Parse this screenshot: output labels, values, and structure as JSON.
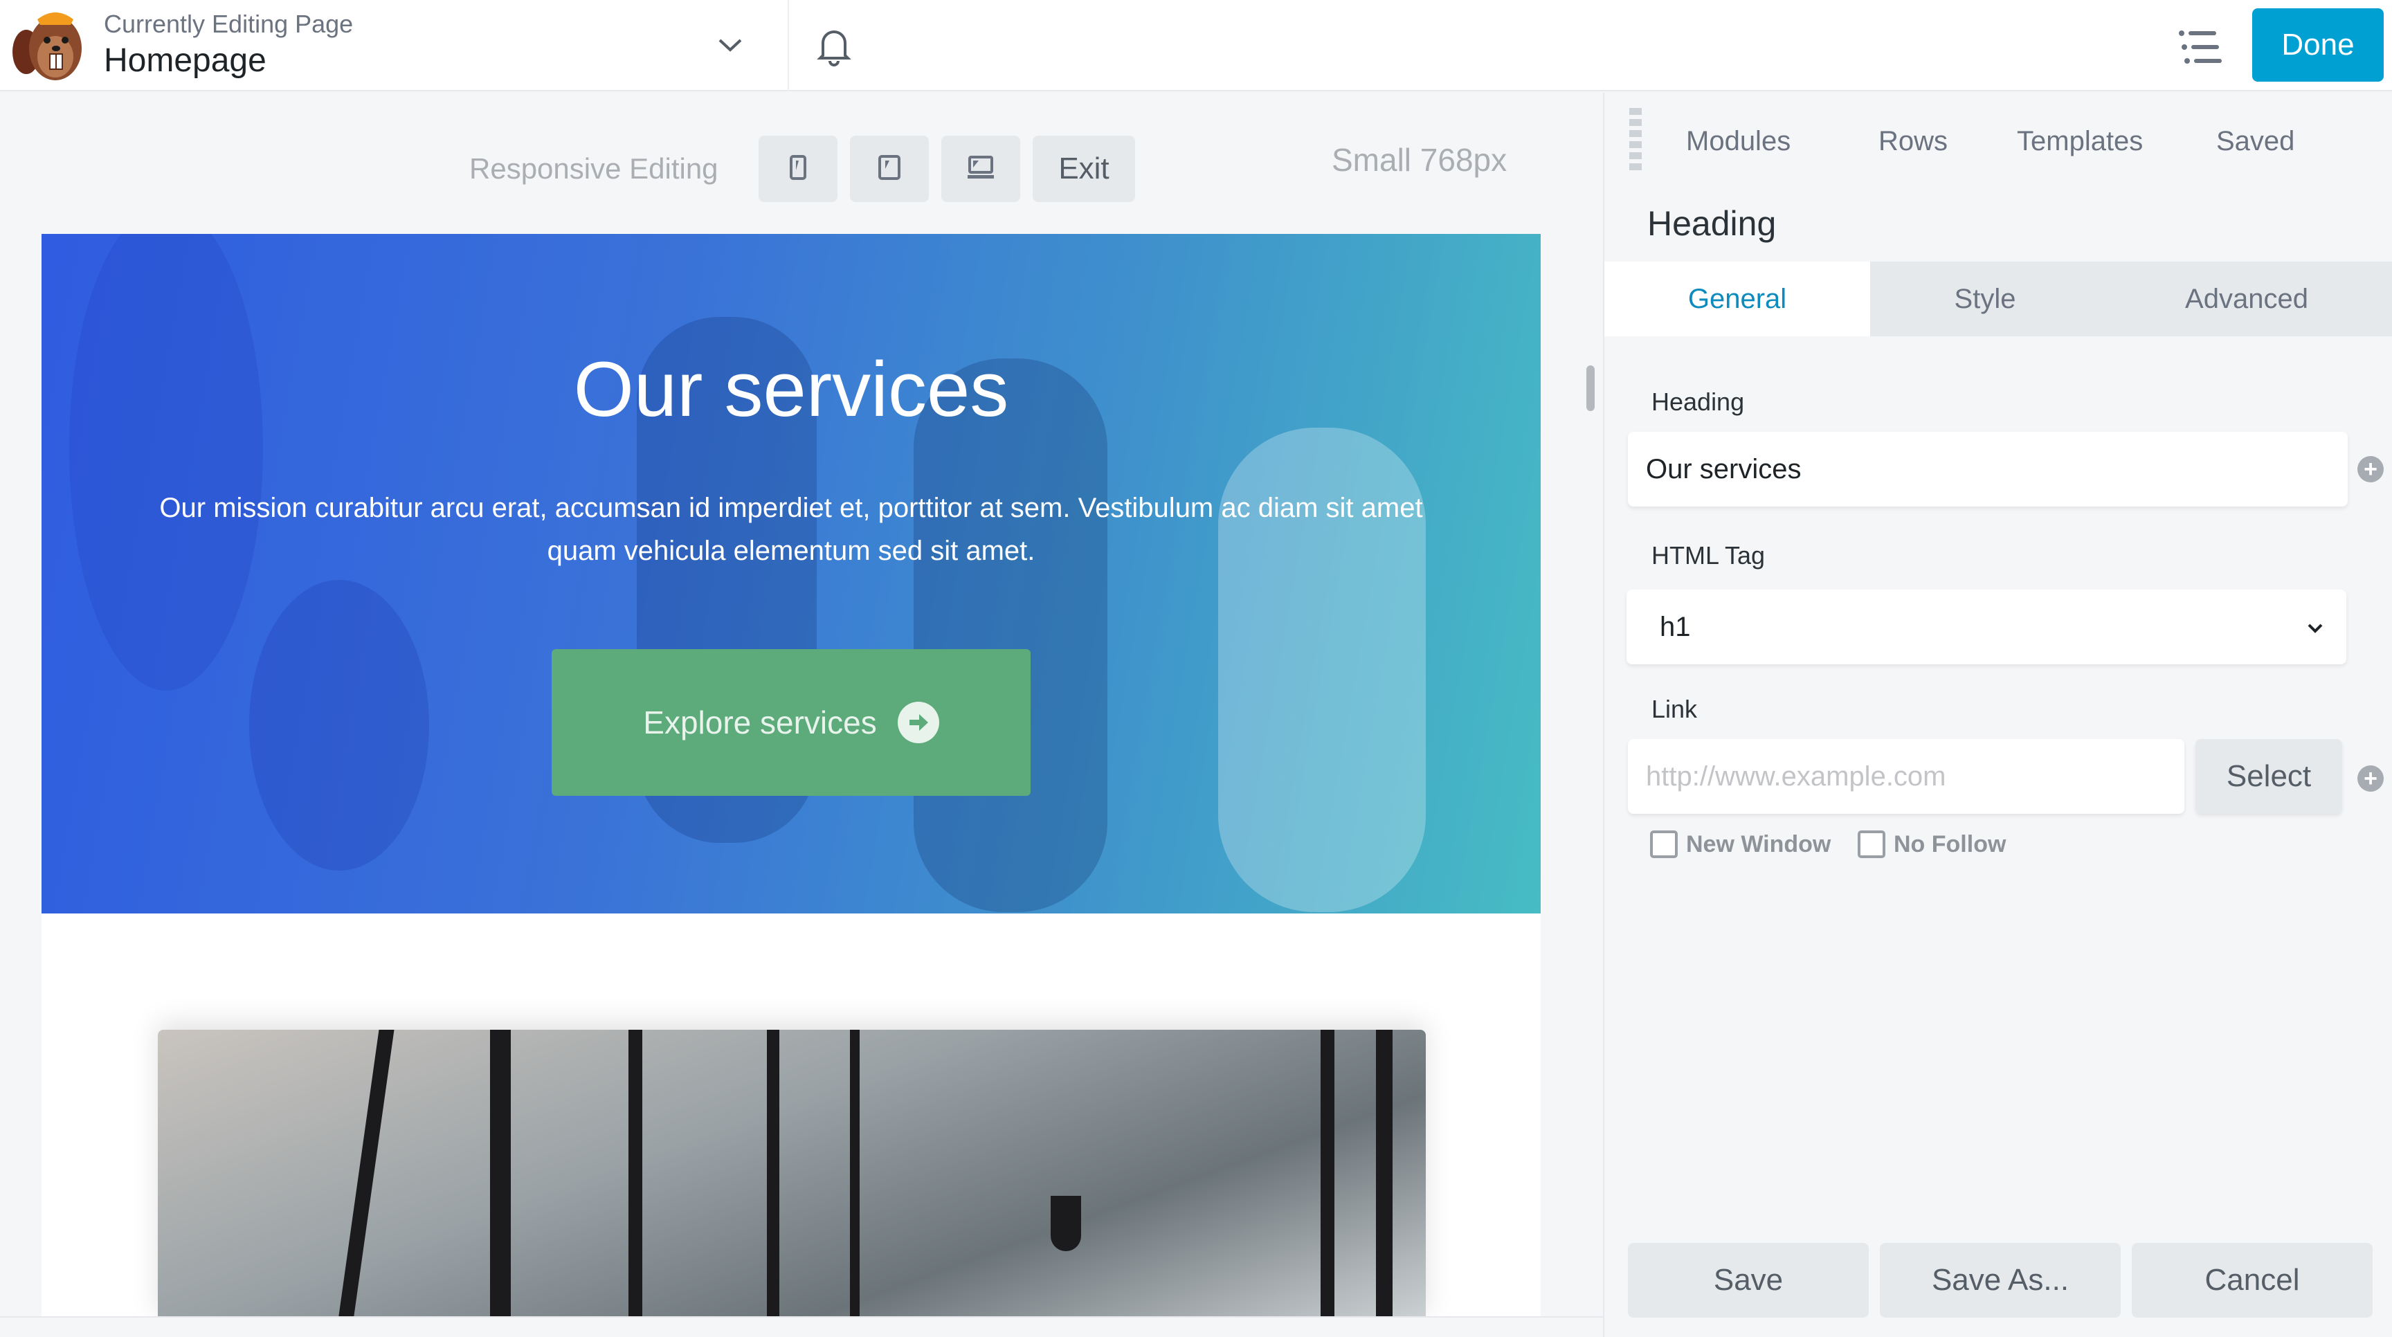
{
  "header": {
    "subtitle": "Currently Editing Page",
    "page_title": "Homepage",
    "done_label": "Done"
  },
  "responsive_bar": {
    "label": "Responsive Editing",
    "exit_label": "Exit",
    "size_label": "Small 768px"
  },
  "canvas": {
    "hero": {
      "title": "Our services",
      "text": "Our mission curabitur arcu erat, accumsan id imperdiet et, porttitor at sem. Vestibulum ac diam sit amet quam vehicula elementum sed sit amet.",
      "button_label": "Explore services"
    }
  },
  "panel": {
    "tabs": [
      "Modules",
      "Rows",
      "Templates",
      "Saved"
    ],
    "module_title": "Heading",
    "subtabs": [
      "General",
      "Style",
      "Advanced"
    ],
    "fields": {
      "heading_label": "Heading",
      "heading_value": "Our services",
      "tag_label": "HTML Tag",
      "tag_value": "h1",
      "link_label": "Link",
      "link_placeholder": "http://www.example.com",
      "select_label": "Select",
      "new_window_label": "New Window",
      "no_follow_label": "No Follow"
    },
    "footer": {
      "save": "Save",
      "save_as": "Save As...",
      "cancel": "Cancel"
    }
  },
  "colors": {
    "accent": "#00a0d2",
    "active_tab": "#0e8bbd",
    "cta_green": "#5daa7b"
  }
}
